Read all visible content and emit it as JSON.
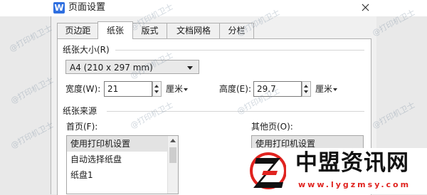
{
  "window": {
    "icon_letter": "W",
    "title": "页面设置"
  },
  "tabs": [
    {
      "label": "页边距",
      "active": false
    },
    {
      "label": "纸张",
      "active": true
    },
    {
      "label": "版式",
      "active": false
    },
    {
      "label": "文档网格",
      "active": false
    },
    {
      "label": "分栏",
      "active": false
    }
  ],
  "paper_size": {
    "group_title": "纸张大小(R)",
    "selected": "A4 (210 x 297 mm)",
    "width_label": "宽度(W):",
    "width_value": "21",
    "width_unit": "厘米",
    "height_label": "高度(E):",
    "height_value": "29.7",
    "height_unit": "厘米"
  },
  "paper_source": {
    "group_title": "纸张来源",
    "first_page_label": "首页(F):",
    "first_page_items": [
      "使用打印机设置",
      "自动选择纸盘",
      "纸盘1"
    ],
    "other_pages_label": "其他页(O):",
    "other_pages_items": [
      "使用打印机设置"
    ]
  },
  "watermark": {
    "text": "@打印机卫士"
  },
  "logo": {
    "title": "中盟资讯网",
    "domain": "www.lygzmsy.com"
  },
  "colors": {
    "accent": "#2f6fe0",
    "logo_red": "#e0231f"
  }
}
